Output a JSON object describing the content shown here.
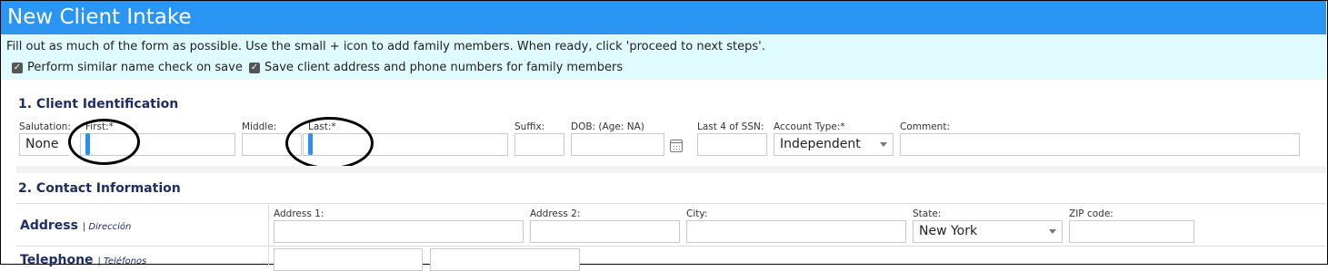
{
  "header": {
    "title": "New Client Intake"
  },
  "info": {
    "message": "Fill out as much of the form as possible. Use the small + icon to add family members. When ready, click 'proceed to next steps'.",
    "checkboxes": [
      {
        "label": "Perform similar name check on save",
        "checked": true
      },
      {
        "label": "Save client address and phone numbers for family members",
        "checked": true
      }
    ]
  },
  "identification": {
    "title": "1. Client Identification",
    "salutation": {
      "label": "Salutation:",
      "value": "None"
    },
    "first": {
      "label": "First:*",
      "value": ""
    },
    "middle": {
      "label": "Middle:",
      "value": ""
    },
    "last": {
      "label": "Last:*",
      "value": ""
    },
    "suffix": {
      "label": "Suffix:",
      "value": ""
    },
    "dob": {
      "label": "DOB: (Age: NA)",
      "value": ""
    },
    "ssn": {
      "label": "Last 4 of SSN:",
      "value": ""
    },
    "account_type": {
      "label": "Account Type:*",
      "value": "Independent"
    },
    "comment": {
      "label": "Comment:",
      "value": ""
    }
  },
  "contact": {
    "title": "2. Contact Information",
    "address": {
      "label": "Address",
      "sublabel": "| Dirección",
      "address1": {
        "label": "Address 1:",
        "value": ""
      },
      "address2": {
        "label": "Address 2:",
        "value": ""
      },
      "city": {
        "label": "City:",
        "value": ""
      },
      "state": {
        "label": "State:",
        "value": "New York"
      },
      "zip": {
        "label": "ZIP code:",
        "value": ""
      }
    },
    "telephone": {
      "label": "Telephone",
      "sublabel": "| Teléfonos"
    }
  },
  "colors": {
    "header": "#2a95f2",
    "info_bg": "#e0fbfd",
    "section_title": "#1e2d63",
    "cursor": "#2a8ff0"
  }
}
